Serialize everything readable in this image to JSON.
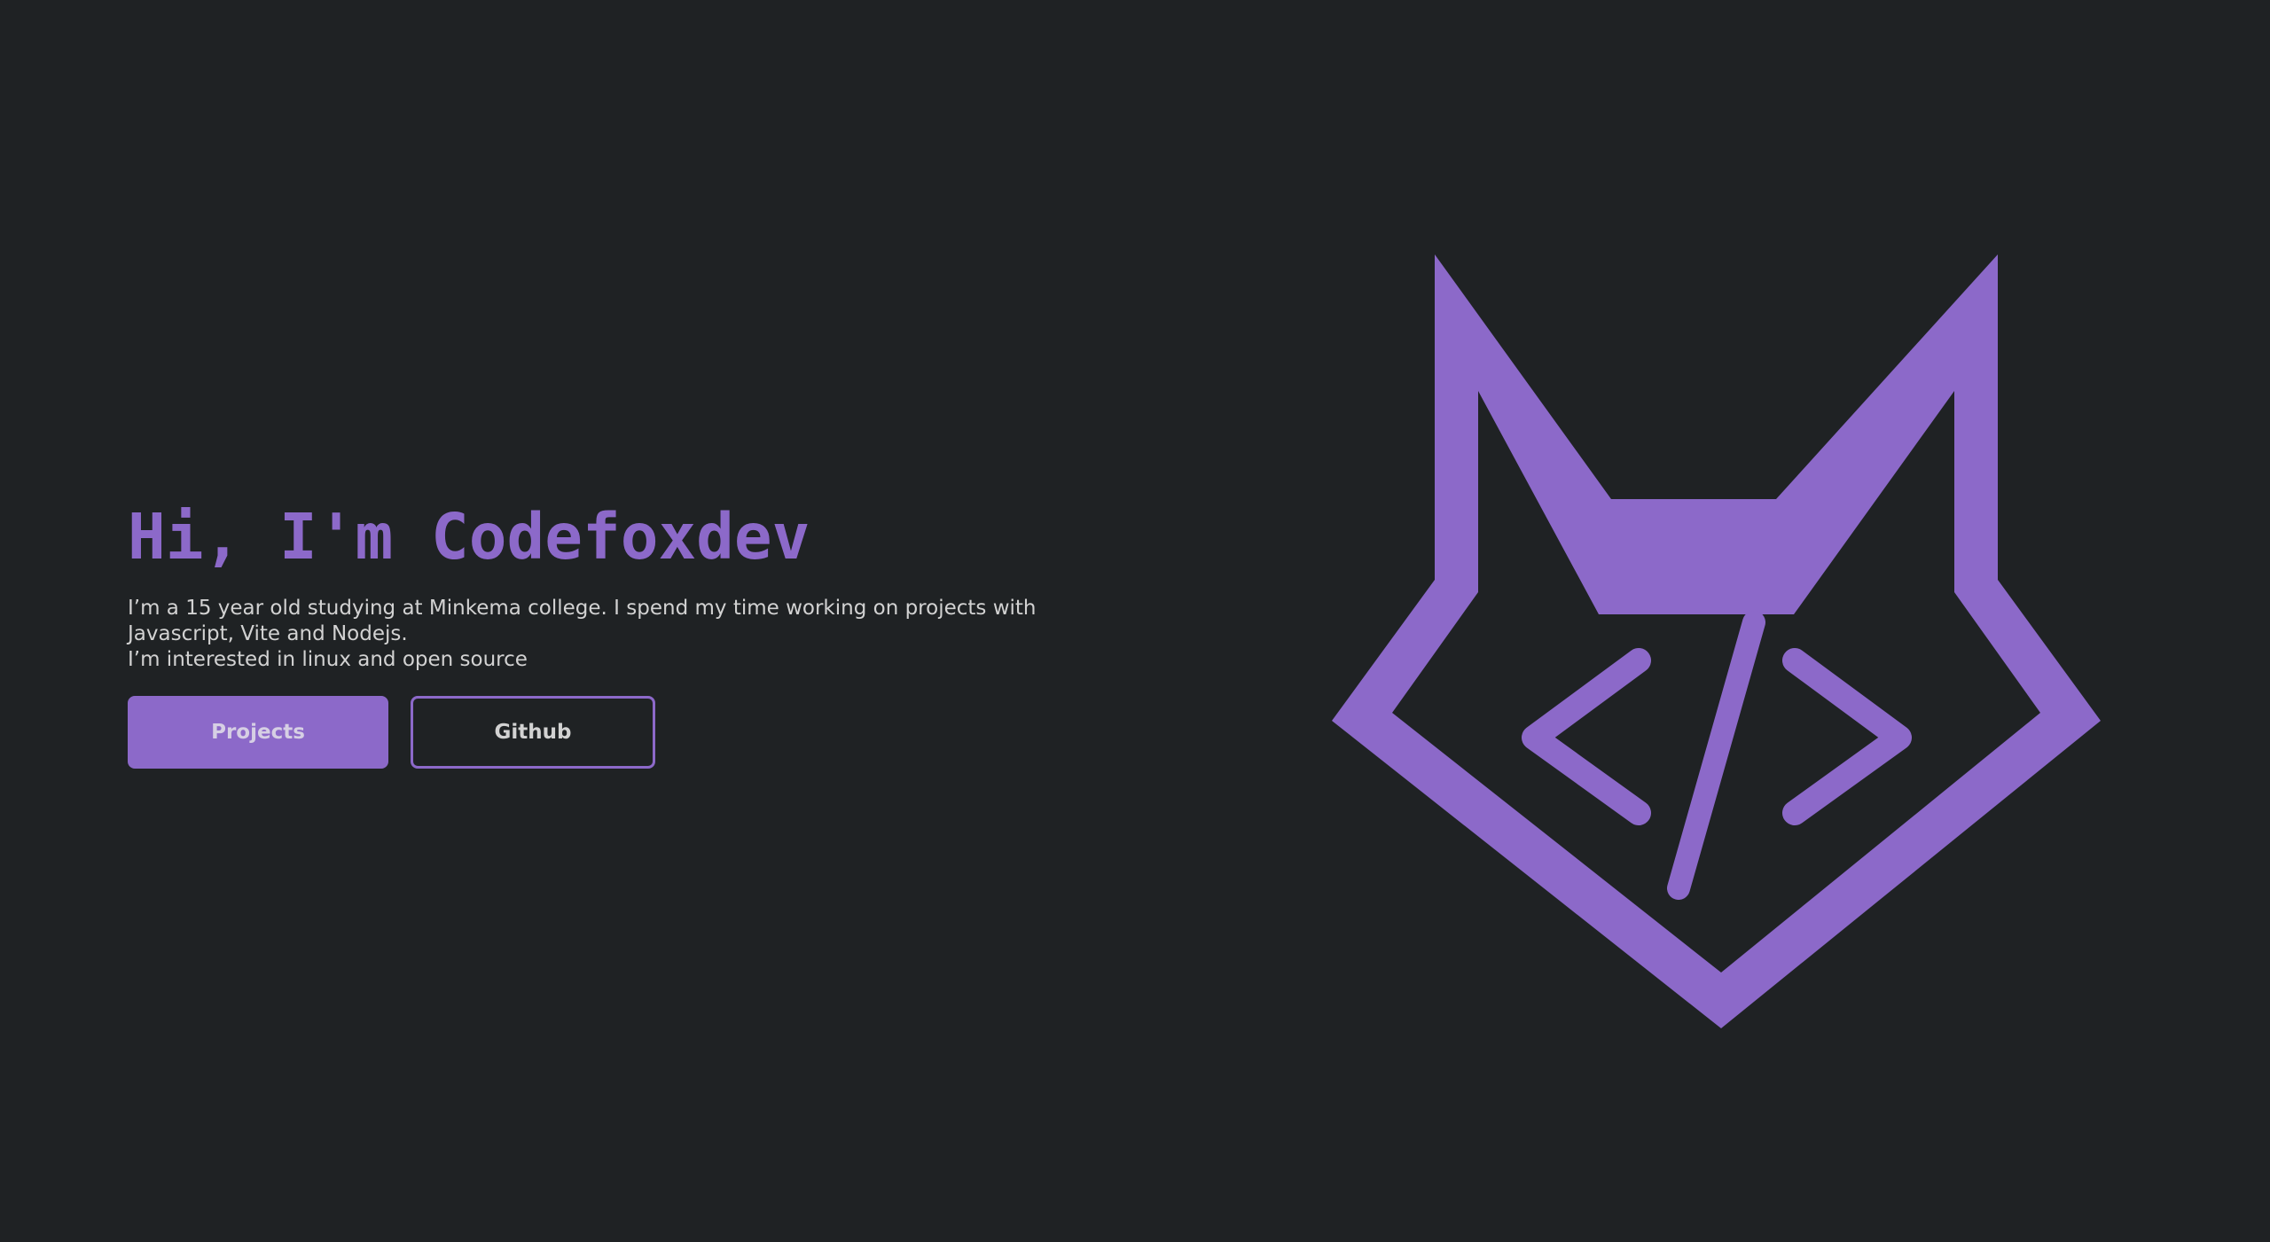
{
  "hero": {
    "title": "Hi, I'm Codefoxdev",
    "bio_lines": [
      "I’m a 15 year old studying at Minkema college. I spend my time working on projects with Javascript, Vite and Nodejs.",
      "I’m interested in linux and open source"
    ]
  },
  "buttons": {
    "projects_label": "Projects",
    "github_label": "Github"
  },
  "logo": {
    "icon": "fox-code-logo-icon",
    "color": "#8c69c9"
  },
  "colors": {
    "background": "#1f2224",
    "accent": "#8c69c9",
    "text": "#d2d2d2"
  }
}
